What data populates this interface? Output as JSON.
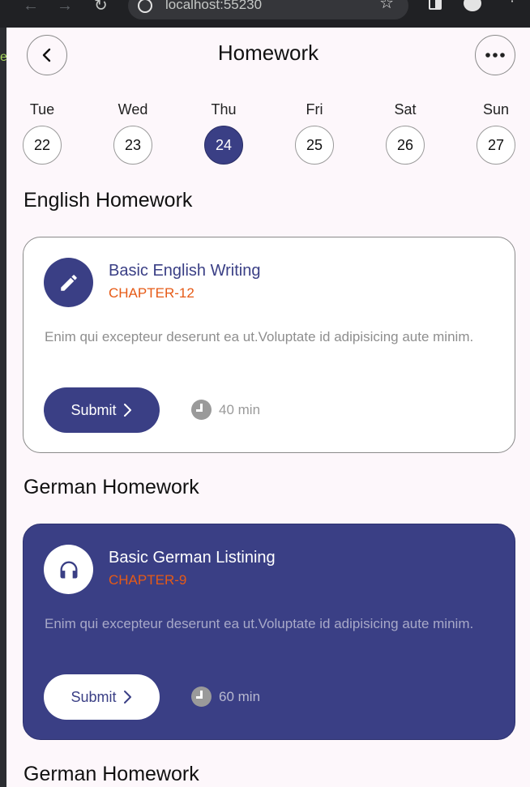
{
  "browser": {
    "url": "localhost:55230",
    "sidebar_glyph": "e"
  },
  "header": {
    "title": "Homework",
    "back_icon": "chevron-left-icon",
    "more_icon": "more-horizontal-icon"
  },
  "calendar": {
    "days": [
      {
        "name": "Tue",
        "date": "22",
        "selected": false
      },
      {
        "name": "Wed",
        "date": "23",
        "selected": false
      },
      {
        "name": "Thu",
        "date": "24",
        "selected": true
      },
      {
        "name": "Fri",
        "date": "25",
        "selected": false
      },
      {
        "name": "Sat",
        "date": "26",
        "selected": false
      },
      {
        "name": "Sun",
        "date": "27",
        "selected": false
      }
    ]
  },
  "sections": [
    {
      "title": "English Homework",
      "card": {
        "title": "Basic English Writing",
        "chapter": "CHAPTER-12",
        "description": "Enim qui excepteur deserunt ea ut.Voluptate id adipisicing aute minim.",
        "submit_label": "Submit",
        "time": "40 min",
        "icon": "pencil-icon",
        "theme": "light"
      }
    },
    {
      "title": "German Homework",
      "card": {
        "title": "Basic German Listining",
        "chapter": "CHAPTER-9",
        "description": "Enim qui excepteur deserunt ea ut.Voluptate id adipisicing aute minim.",
        "submit_label": "Submit",
        "time": "60 min",
        "icon": "headphones-icon",
        "theme": "dark"
      }
    },
    {
      "title": "German Homework"
    }
  ],
  "colors": {
    "primary": "#3a3f85",
    "accent": "#e65a16",
    "background": "#fdf7fb"
  }
}
